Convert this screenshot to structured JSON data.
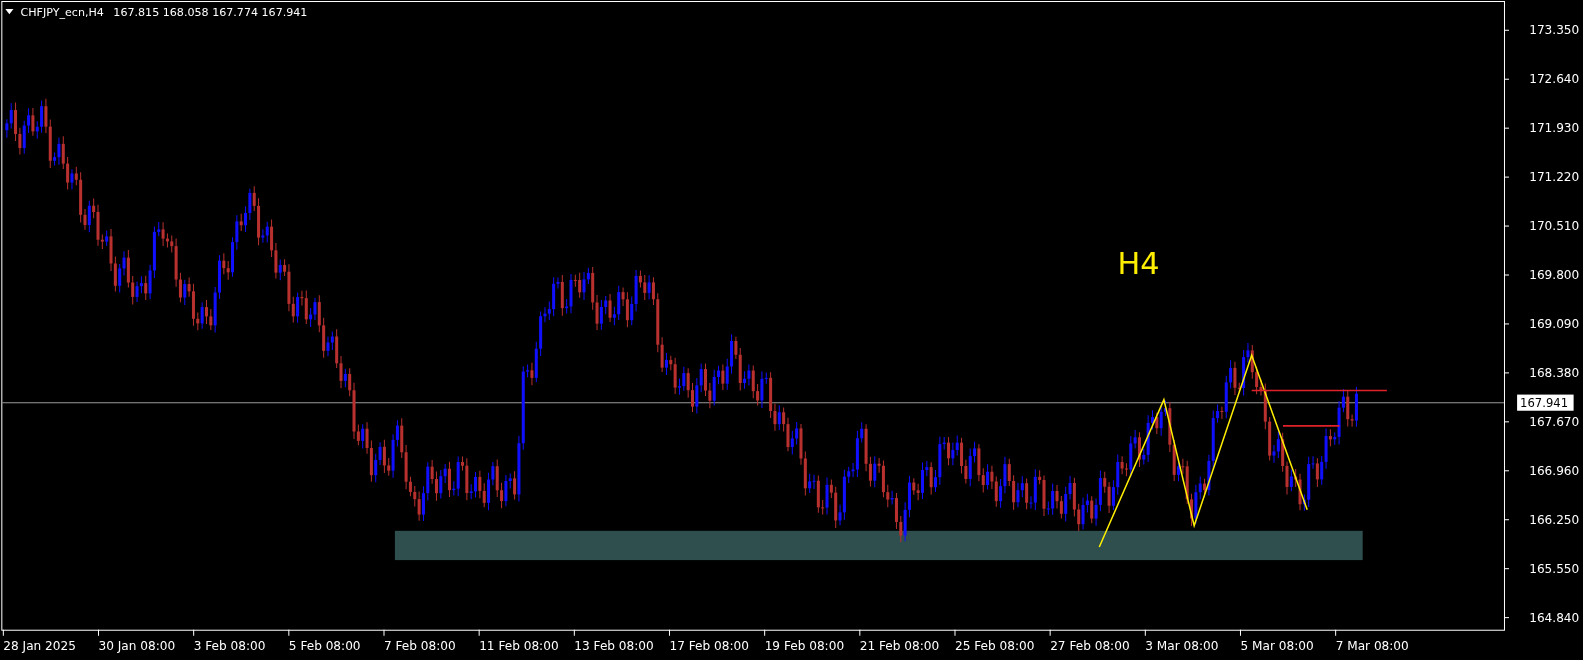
{
  "header": {
    "symbol": "CHFJPY_ecn,H4",
    "ohlc": "167.815 168.058 167.774 167.941"
  },
  "chart_label": "H4",
  "current_price": "167.941",
  "price_axis": [
    "173.350",
    "172.640",
    "171.930",
    "171.220",
    "170.510",
    "169.800",
    "169.090",
    "168.380",
    "167.670",
    "166.960",
    "166.250",
    "165.550",
    "164.840"
  ],
  "time_axis": [
    "28 Jan 2025",
    "30 Jan 08:00",
    "3 Feb 08:00",
    "5 Feb 08:00",
    "7 Feb 08:00",
    "11 Feb 08:00",
    "13 Feb 08:00",
    "17 Feb 08:00",
    "19 Feb 08:00",
    "21 Feb 08:00",
    "25 Feb 08:00",
    "27 Feb 08:00",
    "3 Mar 08:00",
    "5 Mar 08:00",
    "7 Mar 08:00"
  ]
}
